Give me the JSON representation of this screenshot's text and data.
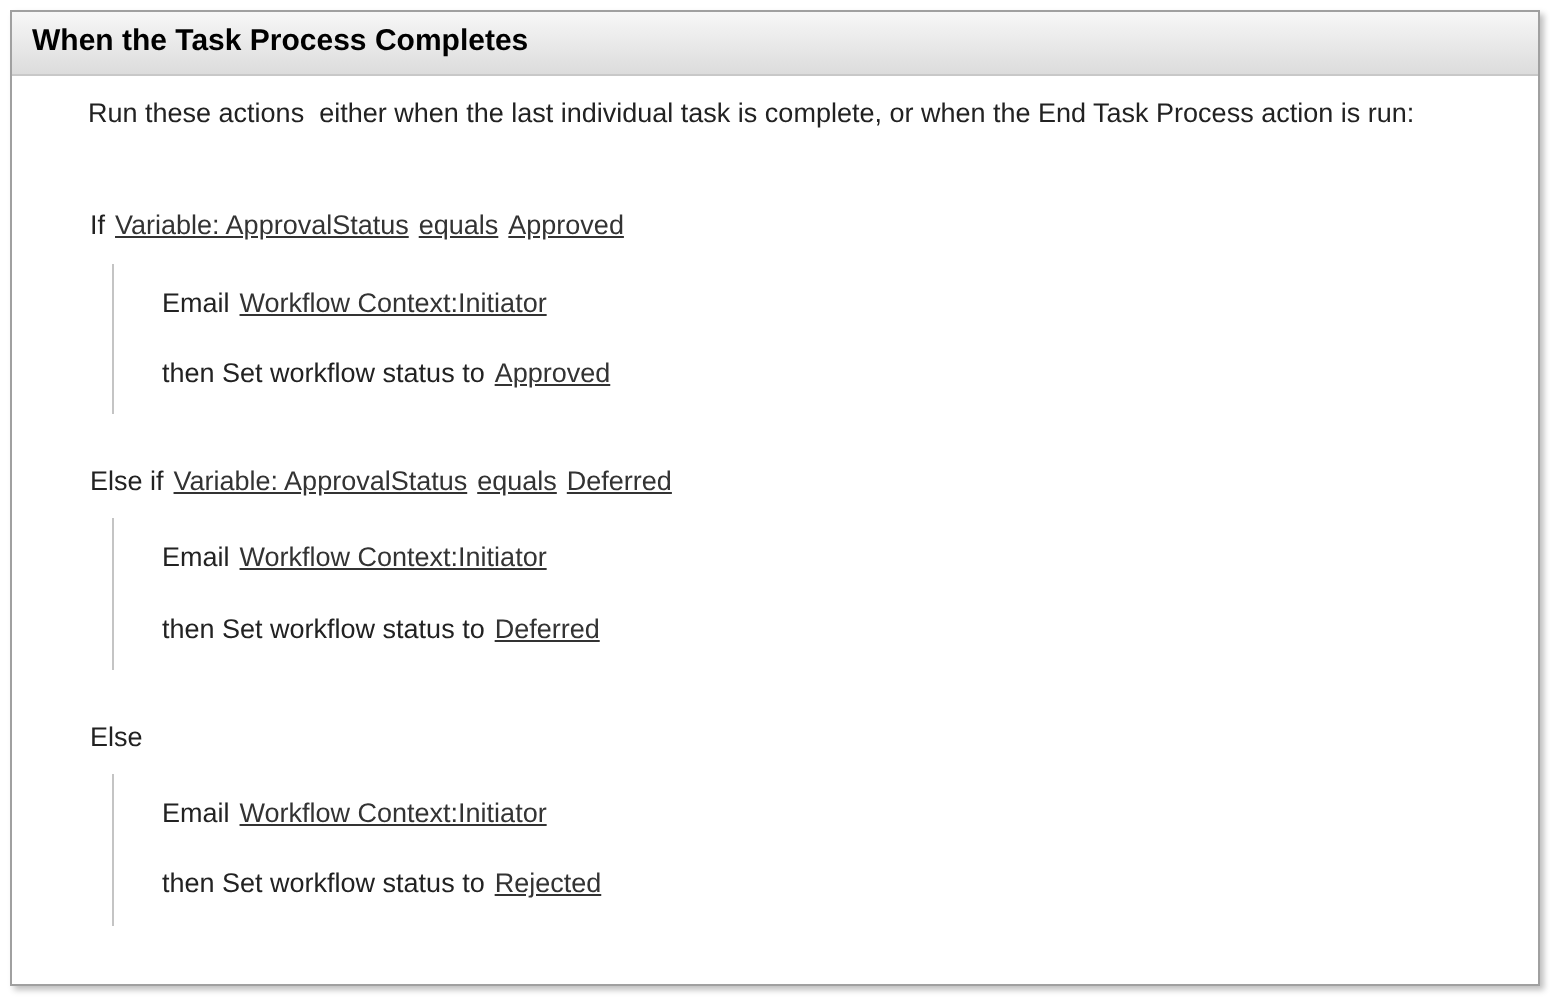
{
  "panel": {
    "title": "When the Task Process Completes",
    "description": "Run these actions  either when the last individual task is complete, or when the End Task Process action is run:"
  },
  "branches": [
    {
      "keyword": "If",
      "condition": [
        "Variable: ApprovalStatus",
        "equals",
        "Approved"
      ],
      "actions": [
        {
          "verb": "Email",
          "link": "Workflow Context:Initiator"
        },
        {
          "verb": "then Set workflow status to",
          "link": "Approved"
        }
      ]
    },
    {
      "keyword": "Else if",
      "condition": [
        "Variable: ApprovalStatus",
        "equals",
        "Deferred"
      ],
      "actions": [
        {
          "verb": "Email",
          "link": "Workflow Context:Initiator"
        },
        {
          "verb": "then Set workflow status to",
          "link": "Deferred"
        }
      ]
    },
    {
      "keyword": "Else",
      "actions": [
        {
          "verb": "Email",
          "link": "Workflow Context:Initiator"
        },
        {
          "verb": "then Set workflow status to",
          "link": "Rejected"
        }
      ]
    }
  ]
}
